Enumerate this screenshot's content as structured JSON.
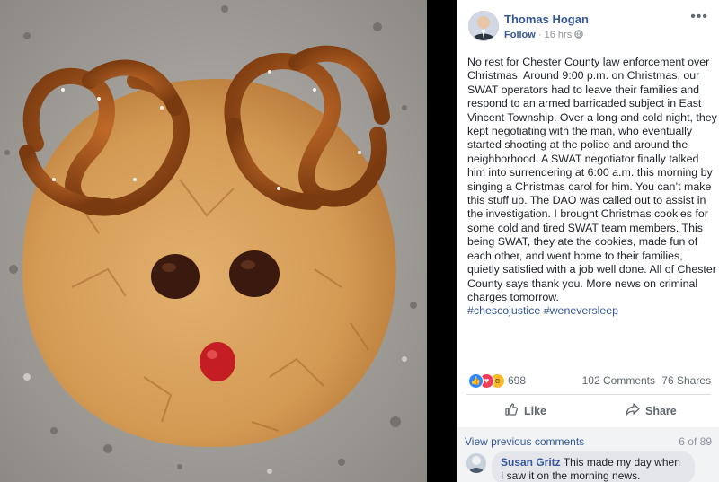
{
  "post": {
    "author": "Thomas Hogan",
    "follow_label": "Follow",
    "time": "16 hrs",
    "menu_glyph": "•••",
    "body": "No rest for Chester County law enforcement over Christmas. Around 9:00 p.m. on Christmas, our SWAT operators had to leave their families and respond to an armed barricaded subject in East Vincent Township. Over a long and cold night, they kept negotiating with the man, who eventually started shooting at the police and around the neighborhood. A SWAT negotiator finally talked him into surrendering at 6:00 a.m. this morning by singing a Christmas carol for him. You can’t make this stuff up. The DAO was called out to assist in the investigation. I brought Christmas cookies for some cold and tired SWAT team members. This being SWAT, they ate the cookies, made fun of each other, and went home to their families, quietly satisfied with a job well done. All of Chester County says thank you. More news on criminal charges tomorrow.",
    "hashtags": "#chescojustice #weneversleep"
  },
  "stats": {
    "reaction_count": "698",
    "comments": "102 Comments",
    "shares": "76 Shares"
  },
  "actions": {
    "like": "Like",
    "share": "Share"
  },
  "comments": {
    "view_previous": "View previous comments",
    "pager": "6 of 89",
    "items": [
      {
        "author": "Susan Gritz",
        "text": "This made my day when I saw it on the morning news."
      }
    ]
  },
  "colors": {
    "link": "#365899",
    "like_blue": "#2d88ff",
    "love_red": "#f33e58",
    "wow_yellow": "#f7b928"
  }
}
